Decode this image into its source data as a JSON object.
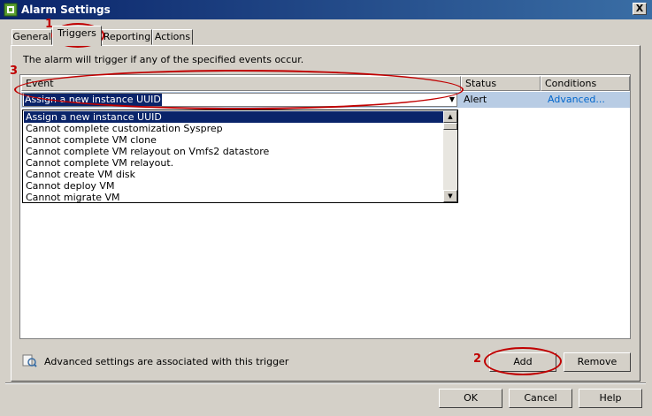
{
  "window": {
    "title": "Alarm Settings",
    "close_label": "X",
    "icon": "alarm-settings-icon"
  },
  "tabs": [
    {
      "label": "General"
    },
    {
      "label": "Triggers",
      "active": true
    },
    {
      "label": "Reporting"
    },
    {
      "label": "Actions"
    }
  ],
  "description": "The alarm will trigger if any of the specified events occur.",
  "grid": {
    "columns": [
      "Event",
      "Status",
      "Conditions"
    ],
    "rows": [
      {
        "event": "Assign a new instance UUID",
        "status": "Alert",
        "conditions": "Advanced..."
      }
    ]
  },
  "dropdown": {
    "items": [
      "Assign a new instance UUID",
      "Cannot complete customization Sysprep",
      "Cannot complete VM clone",
      "Cannot complete VM relayout on Vmfs2 datastore",
      "Cannot complete VM relayout.",
      "Cannot create VM disk",
      "Cannot deploy VM",
      "Cannot migrate VM"
    ],
    "selected_index": 0
  },
  "footer": {
    "info_text": "Advanced settings are associated with this trigger",
    "add_label": "Add",
    "remove_label": "Remove",
    "ok_label": "OK",
    "cancel_label": "Cancel",
    "help_label": "Help"
  },
  "callouts": {
    "triggers_tab": "1",
    "add_button": "2",
    "event_column": "3"
  },
  "colors": {
    "callout": "#c00000",
    "selection": "#0a246a",
    "link": "#0066cc"
  }
}
